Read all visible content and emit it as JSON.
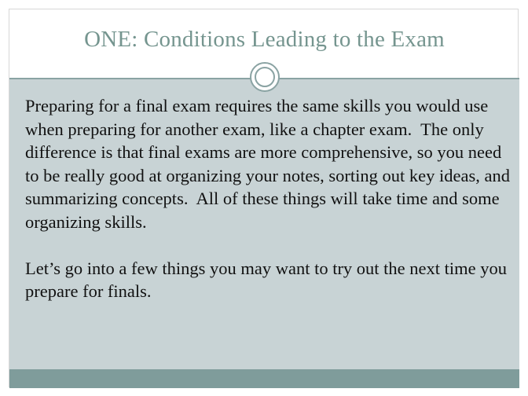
{
  "slide": {
    "title": "ONE: Conditions Leading to the Exam",
    "paragraphs": [
      "Preparing for a final exam requires the same skills you would use when preparing for another exam, like a chapter exam.  The only difference is that final exams are more comprehensive, so you need to be really good at organizing your notes, sorting out key ideas, and summarizing concepts.  All of these things will take time and some organizing skills.",
      "Let’s go into a few things you may want to try out the next time you prepare for finals."
    ]
  },
  "colors": {
    "title": "#75958f",
    "body_panel": "#c8d3d5",
    "accent": "#8aa3a3",
    "footer_bar": "#7f9c9b"
  }
}
